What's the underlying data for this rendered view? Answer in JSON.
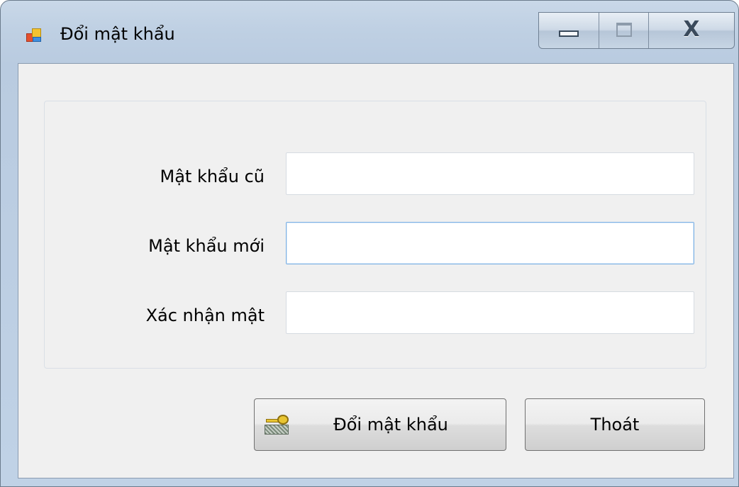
{
  "window": {
    "title": "Đổi mật khẩu",
    "app_icon": "form-app-icon",
    "controls": {
      "minimize_icon": "minimize-icon",
      "maximize_icon": "maximize-icon",
      "close_glyph": "X"
    }
  },
  "form": {
    "fields": [
      {
        "label": "Mật khẩu cũ",
        "value": "",
        "placeholder": ""
      },
      {
        "label": "Mật khẩu mới",
        "value": "",
        "placeholder": ""
      },
      {
        "label": "Xác nhận mật",
        "value": "",
        "placeholder": ""
      }
    ],
    "focused_field_index": 1
  },
  "buttons": {
    "change_password_label": "Đổi mật khẩu",
    "change_password_icon": "key-icon",
    "exit_label": "Thoát"
  },
  "colors": {
    "focus_border": "#7fb2e4",
    "window_frame": "#bfd0e3",
    "client_background": "#f0f0f0"
  }
}
